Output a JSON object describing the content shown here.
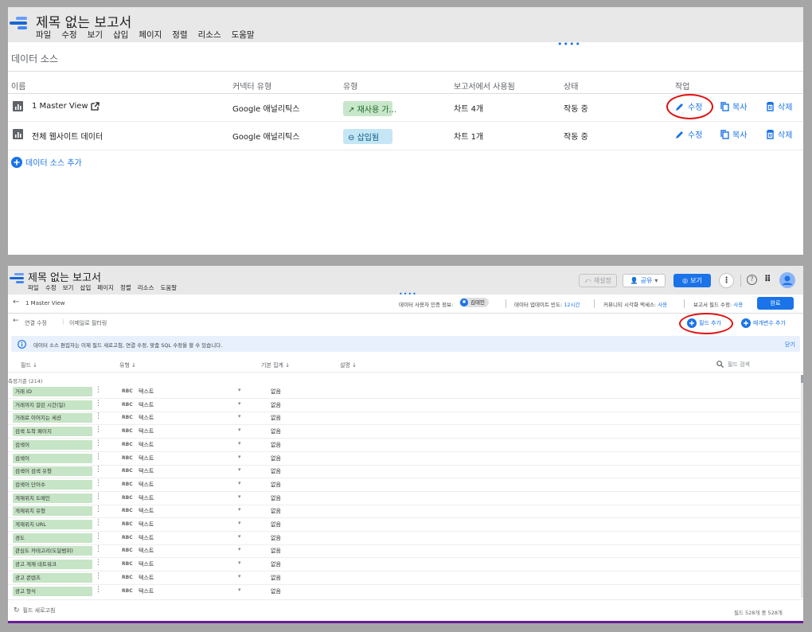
{
  "colors": {
    "accent": "#1a73e8",
    "header_bg": "#e8e8e8",
    "field_chip": "#c6e4c6",
    "highlight_circle": "#e01010"
  },
  "top": {
    "title": "제목 없는 보고서",
    "menu": [
      "파일",
      "수정",
      "보기",
      "삽입",
      "페이지",
      "정렬",
      "리소스",
      "도움말"
    ],
    "section_title": "데이터 소스",
    "columns": [
      "이름",
      "커넥터 유형",
      "유형",
      "보고서에서 사용됨",
      "상태",
      "작업"
    ],
    "rows": [
      {
        "name": "1 Master View",
        "connector": "Google 애널리틱스",
        "type": "재사용 가...",
        "used": "차트 4개",
        "status": "작동 중",
        "edit": "수정",
        "copy": "복사",
        "delete": "삭제"
      },
      {
        "name": "전체 웹사이트 데이터",
        "connector": "Google 애널리틱스",
        "type": "삽입됨",
        "used": "차트 1개",
        "status": "작동 중",
        "edit": "수정",
        "copy": "복사",
        "delete": "삭제"
      }
    ],
    "add_source": "데이터 소스 추가"
  },
  "bottom": {
    "title": "제목 없는 보고서",
    "menu": [
      "파일",
      "수정",
      "보기",
      "삽입",
      "페이지",
      "정렬",
      "리소스",
      "도움말"
    ],
    "toolbar": {
      "reset": "재설정",
      "share": "공유",
      "view": "보기"
    },
    "back_label": "1 Master View",
    "credentials_label": "데이터 사용자 인증 정보:",
    "credentials_user": "김태인",
    "freshness_label": "데이터 업데이트 빈도:",
    "freshness_value": "12시간",
    "community_label": "커뮤니티 시각화 액세스:",
    "community_value": "사용",
    "report_edit_label": "보고서 필드 수정:",
    "report_edit_value": "사용",
    "done": "완료",
    "edit_connection": "연결 수정",
    "email_filter": "이메일로 필터링",
    "add_field": "필드 추가",
    "add_param": "매개변수 추가",
    "notice": "데이터 소스 편집자는 이제 필드 새로고침, 연결 수정, 맞춤 SQL 수정을 할 수 있습니다.",
    "close": "닫기",
    "headers": {
      "field": "필드",
      "type": "유형",
      "aggregation": "기본 집계",
      "description": "설명"
    },
    "search_placeholder": "필드 검색",
    "group_label": "측정기준 (214)",
    "type_abc": "RBC",
    "type_text": "텍스트",
    "agg_none": "없음",
    "fields": [
      "거래 ID",
      "거래까지 걸린 시간(일)",
      "거래로 이어지는 세션",
      "검색 도착 페이지",
      "검색어",
      "검색어",
      "검색어 검색 유형",
      "검색어 단어수",
      "게재위치 도메인",
      "게재위치 유형",
      "게재위치 URL",
      "경도",
      "관심도 카테고리(도달범위)",
      "광고 게재 네트워크",
      "광고 콘텐츠",
      "광고 형식"
    ],
    "refresh_fields": "필드 새로고침",
    "field_count": "필드 528개 중 528개"
  }
}
